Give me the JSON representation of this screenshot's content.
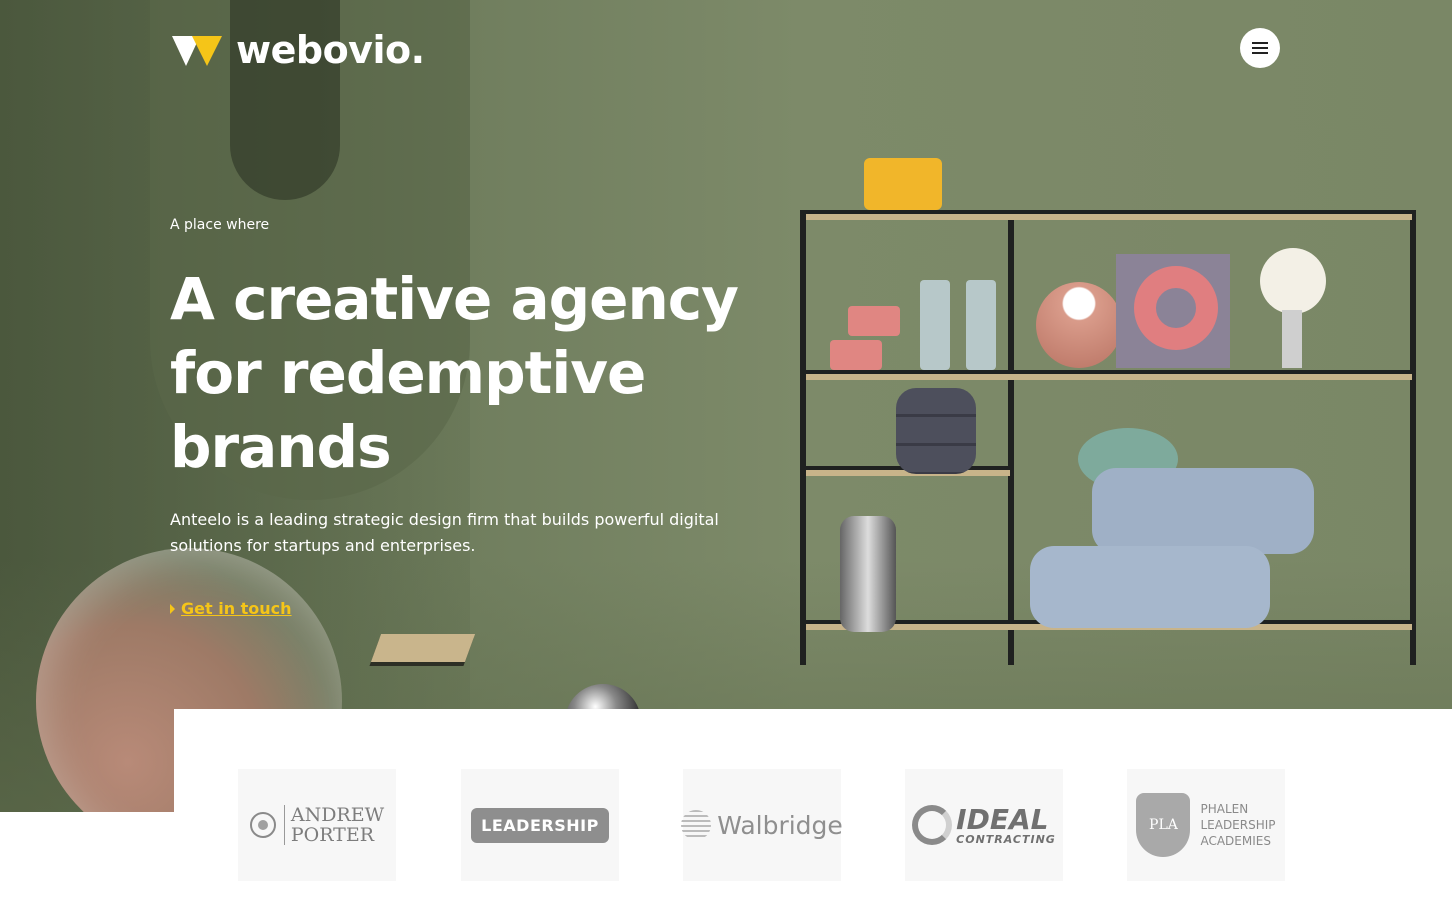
{
  "brand": {
    "name": "webovio.",
    "accent_color": "#f5c518",
    "hero_bg_color": "#727f60"
  },
  "header": {
    "menu_icon": "hamburger-icon"
  },
  "hero": {
    "eyebrow": "A place where",
    "headline_line1": "A creative agency",
    "headline_line2": "for redemptive",
    "headline_line3": "brands",
    "intro": "Anteelo is a leading strategic design firm that builds powerful digital solutions for startups and enterprises.",
    "cta_label": "Get in touch",
    "cta_icon": "caret-right-icon"
  },
  "clients": [
    {
      "name": "ANDREW PORTER",
      "line1": "ANDREW",
      "line2": "PORTER"
    },
    {
      "name": "LEADERSHIP",
      "label": "LEADERSHIP"
    },
    {
      "name": "Walbridge",
      "label": "Walbridge"
    },
    {
      "name": "IDEAL CONTRACTING",
      "line1": "IDEAL",
      "line2": "CONTRACTING"
    },
    {
      "name": "PHALEN LEADERSHIP ACADEMIES",
      "crest": "PLA",
      "line1": "PHALEN",
      "line2": "LEADERSHIP",
      "line3": "ACADEMIES"
    }
  ]
}
